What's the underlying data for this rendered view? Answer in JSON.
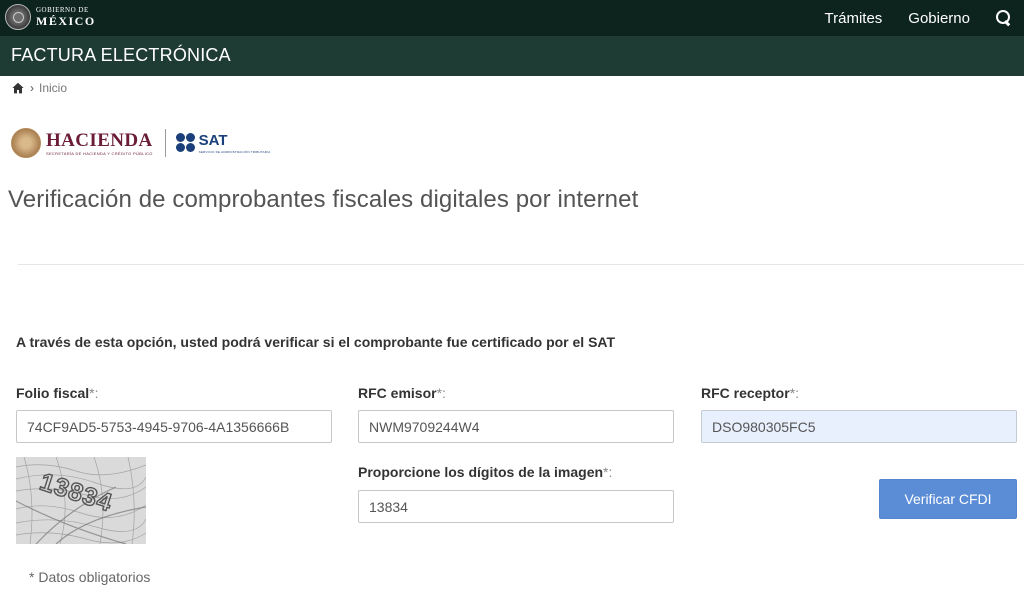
{
  "header": {
    "gov_line1": "GOBIERNO DE",
    "gov_line2": "MÉXICO",
    "nav": [
      {
        "label": "Trámites"
      },
      {
        "label": "Gobierno"
      }
    ],
    "search_icon": "search-icon"
  },
  "subheader": {
    "title": "FACTURA ELECTRÓNICA"
  },
  "breadcrumb": {
    "home_icon": "home-icon",
    "separator": "›",
    "current": "Inicio"
  },
  "logos": {
    "hacienda": "HACIENDA",
    "hacienda_sub": "SECRETARÍA DE HACIENDA Y CRÉDITO PÚBLICO",
    "sat": "SAT",
    "sat_sub": "SERVICIO DE ADMINISTRACIÓN TRIBUTARIA"
  },
  "page": {
    "title": "Verificación de comprobantes fiscales digitales por internet",
    "intro": "A través de esta opción, usted podrá verificar si el comprobante fue certificado por el SAT"
  },
  "form": {
    "folio": {
      "label": "Folio fiscal",
      "req": "*:",
      "value": "74CF9AD5-5753-4945-9706-4A1356666B"
    },
    "rfc_emisor": {
      "label": "RFC emisor",
      "req": "*:",
      "value": "NWM9709244W4"
    },
    "rfc_receptor": {
      "label": "RFC receptor",
      "req": "*:",
      "value": "DSO980305FC5"
    },
    "captcha_text": "13834",
    "digits": {
      "label": "Proporcione los dígitos de la imagen",
      "req": "*:",
      "value": "13834"
    },
    "verify_label": "Verificar CFDI",
    "required_note": "* Datos obligatorios"
  },
  "colors": {
    "topbar": "#0c231e",
    "subbar": "#1f3c34",
    "button": "#5b8dd6",
    "hacienda": "#6b1d36",
    "sat": "#1b3f7a"
  }
}
